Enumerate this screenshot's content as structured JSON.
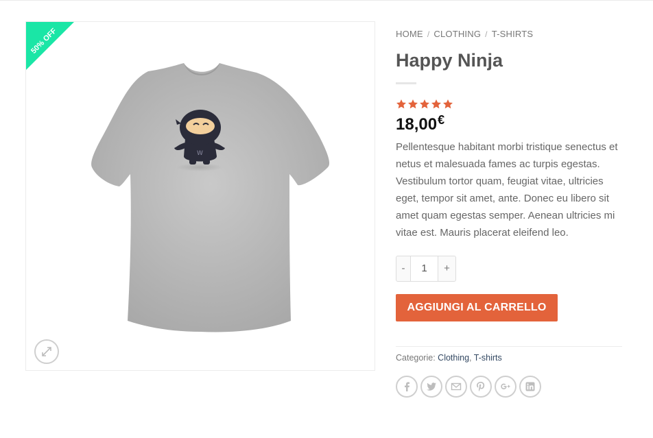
{
  "sale_badge": {
    "text": "50% OFF",
    "color": "#1ae6a6"
  },
  "breadcrumb": {
    "home": "HOME",
    "sep": "/",
    "category": "CLOTHING",
    "subcategory": "T-SHIRTS"
  },
  "product": {
    "title": "Happy Ninja",
    "rating": 5,
    "rating_color": "#e3633b",
    "price_value": "18,00",
    "price_currency": "€",
    "description": "Pellentesque habitant morbi tristique senectus et netus et malesuada fames ac turpis egestas. Vestibulum tortor quam, feugiat vitae, ultricies eget, tempor sit amet, ante. Donec eu libero sit amet quam egestas semper. Aenean ultricies mi vitae est. Mauris placerat eleifend leo."
  },
  "cart": {
    "minus": "-",
    "plus": "+",
    "quantity": "1",
    "add_label": "AGGIUNGI AL CARRELLO",
    "accent": "#e3633b"
  },
  "meta": {
    "categories_label": "Categorie:",
    "cat1": "Clothing",
    "comma": ",",
    "cat2": "T-shirts"
  },
  "icons": {
    "zoom": "expand-icon",
    "share": [
      "facebook-icon",
      "twitter-icon",
      "email-icon",
      "pinterest-icon",
      "google-plus-icon",
      "linkedin-icon"
    ]
  }
}
